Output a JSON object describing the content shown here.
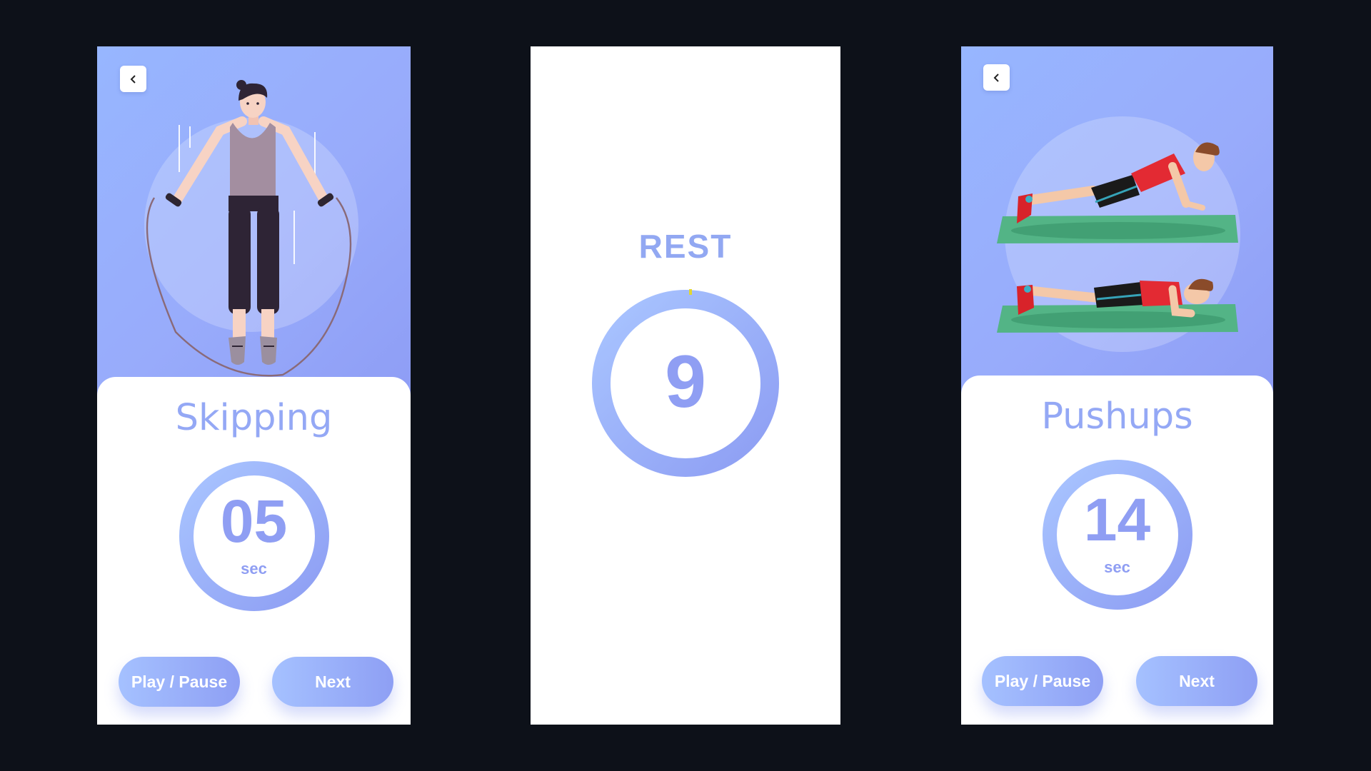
{
  "theme": {
    "accent": "#94a8f5",
    "accent_dark": "#8f9ef3",
    "background": "#0d1119"
  },
  "screens": {
    "skipping": {
      "title": "Skipping",
      "timer": {
        "value": "05",
        "unit": "sec"
      },
      "illustration": "jump-rope-woman",
      "buttons": {
        "play_pause": "Play / Pause",
        "next": "Next"
      }
    },
    "rest": {
      "title": "REST",
      "countdown": "9"
    },
    "pushups": {
      "title": "Pushups",
      "timer": {
        "value": "14",
        "unit": "sec"
      },
      "illustration": "pushup-man",
      "buttons": {
        "play_pause": "Play / Pause",
        "next": "Next"
      }
    }
  }
}
